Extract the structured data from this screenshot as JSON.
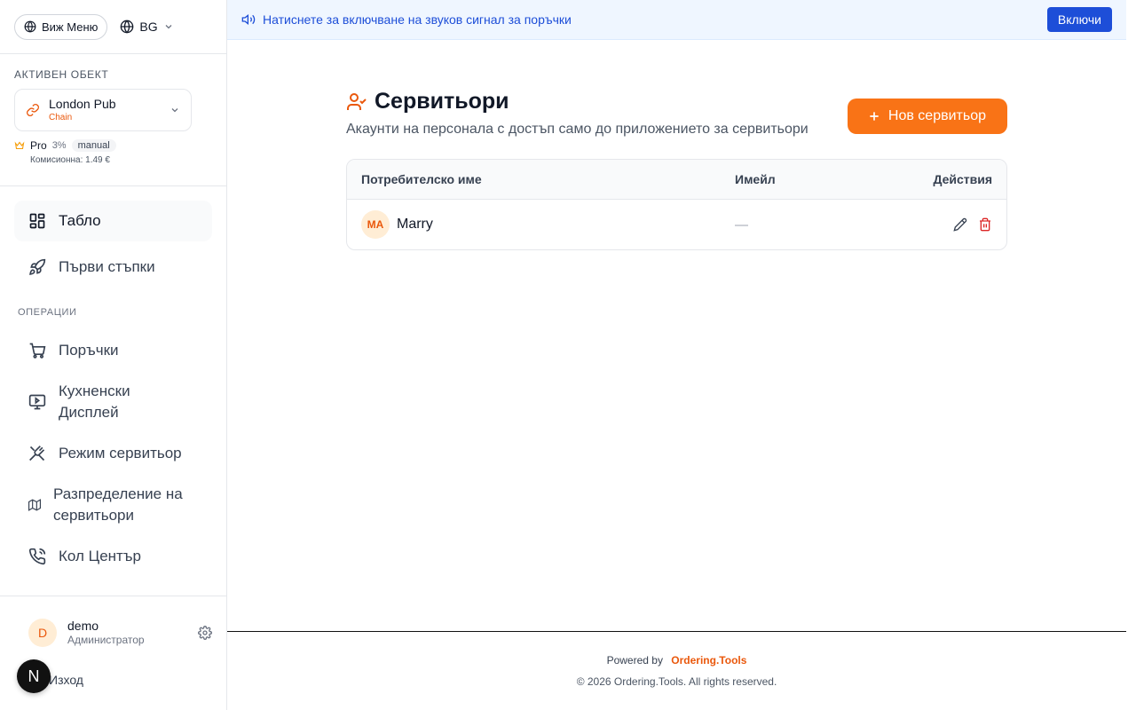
{
  "sidebar": {
    "menu_button": "Виж Меню",
    "language": "BG",
    "active_venue_label": "АКТИВЕН ОБЕКТ",
    "venue": {
      "name": "London Pub",
      "type": "Chain"
    },
    "plan": {
      "name": "Pro",
      "percent": "3%",
      "mode": "manual",
      "commission": "Комисионна: 1.49 €"
    },
    "nav_top": [
      {
        "label": "Табло",
        "icon": "dashboard-icon"
      },
      {
        "label": "Първи стъпки",
        "icon": "rocket-icon"
      }
    ],
    "section_operations": "ОПЕРАЦИИ",
    "nav_ops": [
      {
        "label": "Поръчки",
        "icon": "cart-icon"
      },
      {
        "label": "Кухненски Дисплей",
        "icon": "monitor-icon"
      },
      {
        "label": "Режим сервитьор",
        "icon": "utensils-icon"
      },
      {
        "label": "Разпределение на сервитьори",
        "icon": "map-icon"
      },
      {
        "label": "Кол Център",
        "icon": "phone-icon"
      }
    ],
    "user": {
      "initial": "D",
      "name": "demo",
      "role": "Администратор"
    },
    "logout": "Изход",
    "next_badge": "N"
  },
  "banner": {
    "text": "Натиснете за включване на звуков сигнал за поръчки",
    "button": "Включи"
  },
  "page": {
    "title": "Сервитьори",
    "subtitle": "Акаунти на персонала с достъп само до приложението за сервитьори",
    "new_button": "Нов сервитьор"
  },
  "table": {
    "headers": {
      "user": "Потребителско име",
      "email": "Имейл",
      "actions": "Действия"
    },
    "rows": [
      {
        "initials": "MA",
        "name": "Marry",
        "email": "—"
      }
    ]
  },
  "footer": {
    "powered_by": "Powered by",
    "brand": "Ordering.Tools",
    "copyright": "© 2026 Ordering.Tools. All rights reserved."
  },
  "colors": {
    "accent": "#f97316",
    "blue": "#1d4ed8",
    "danger": "#dc2626"
  }
}
